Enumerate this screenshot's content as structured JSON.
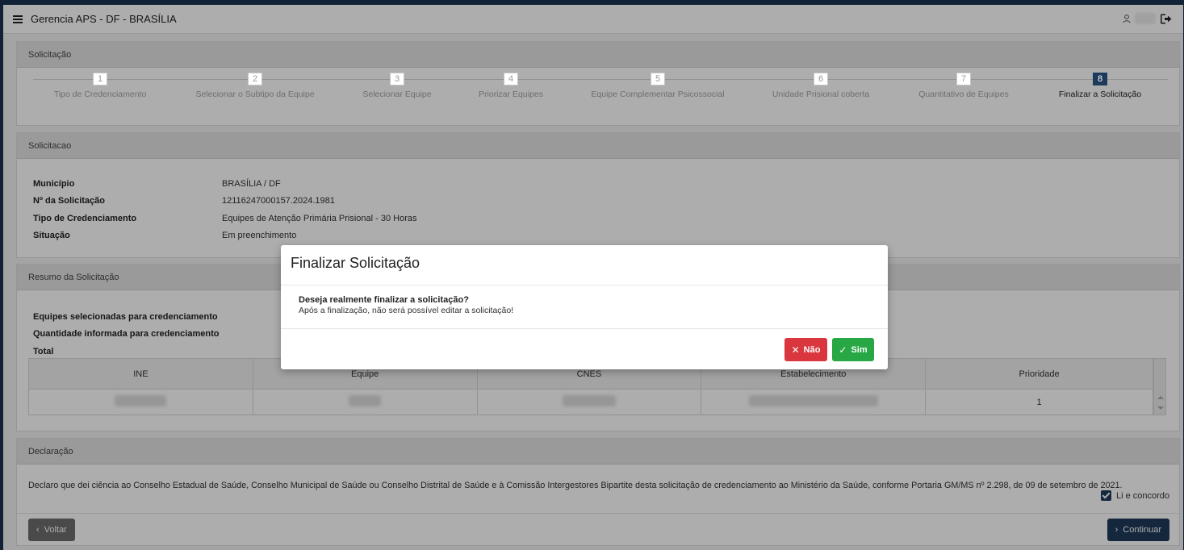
{
  "header": {
    "title": "Gerencia APS -  DF - BRASÍLIA"
  },
  "stepper": {
    "panel_title": "Solicitação",
    "steps": [
      {
        "num": "1",
        "label": "Tipo de Credenciamento"
      },
      {
        "num": "2",
        "label": "Selecionar o Subtipo da Equipe"
      },
      {
        "num": "3",
        "label": "Selecionar Equipe"
      },
      {
        "num": "4",
        "label": "Priorizar Equipes"
      },
      {
        "num": "5",
        "label": "Equipe Complementar Psicossocial"
      },
      {
        "num": "6",
        "label": "Unidade Prisional coberta"
      },
      {
        "num": "7",
        "label": "Quantitativo de Equipes"
      },
      {
        "num": "8",
        "label": "Finalizar a Solicitação"
      }
    ],
    "active_step": 8
  },
  "solicitacao": {
    "panel_title": "Solicitacao",
    "rows": [
      {
        "key": "Município",
        "value": "BRASÍLIA / DF"
      },
      {
        "key": "Nº da Solicitação",
        "value": "12116247000157.2024.1981"
      },
      {
        "key": "Tipo de Credenciamento",
        "value": "Equipes de Atenção Primária Prisional - 30 Horas"
      },
      {
        "key": "Situação",
        "value": "Em preenchimento"
      }
    ]
  },
  "resumo": {
    "panel_title": "Resumo da Solicitação",
    "rows": [
      "Equipes selecionadas para credenciamento",
      "Quantidade informada para credenciamento",
      "Total"
    ],
    "table": {
      "headers": [
        "INE",
        "Equipe",
        "CNES",
        "Estabelecimento",
        "Prioridade"
      ],
      "rows": [
        [
          "",
          "",
          "",
          "",
          "1"
        ]
      ]
    }
  },
  "declaracao": {
    "panel_title": "Declaração",
    "text": "Declaro que dei ciência ao Conselho Estadual de Saúde, Conselho Municipal de Saúde ou Conselho Distrital de Saúde e à Comissão Intergestores Bipartite desta solicitação de credenciamento ao Ministério da Saúde, conforme Portaria GM/MS nº 2.298, de 09 de setembro de 2021.",
    "agree_label": "Li e concordo",
    "agree_checked": true,
    "back_label": "Voltar",
    "continue_label": "Continuar"
  },
  "modal": {
    "title": "Finalizar Solicitação",
    "question": "Deseja realmente finalizar a solicitação?",
    "note": "Após a finalização, não será possível editar a solicitação!",
    "no_label": "Não",
    "yes_label": "Sim"
  },
  "colors": {
    "primary": "#1e3a5a",
    "danger": "#d9363e",
    "success": "#28a745",
    "secondary": "#6d6d6d"
  },
  "icons": [
    "menu-icon",
    "user-icon",
    "logout-icon",
    "chevron-left-icon",
    "chevron-right-icon",
    "close-icon",
    "check-icon"
  ]
}
